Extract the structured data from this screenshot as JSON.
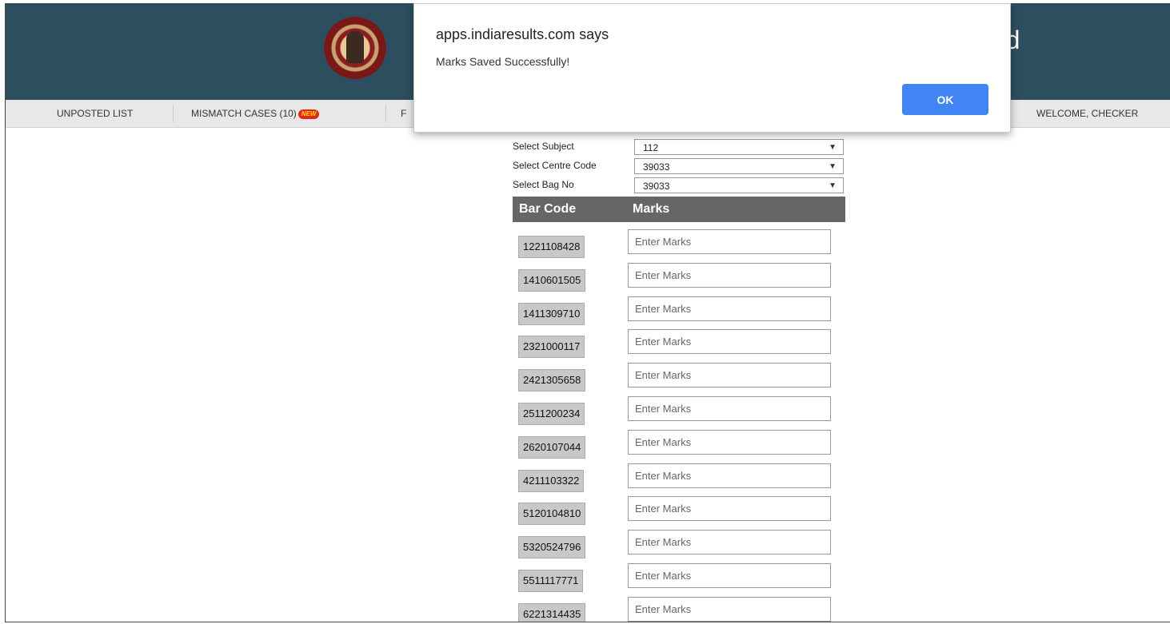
{
  "header": {
    "title_partial": "rd"
  },
  "nav": {
    "items": [
      {
        "label": "UNPOSTED LIST"
      },
      {
        "label": "MISMATCH CASES (10)",
        "badge": "NEW"
      },
      {
        "label": "F"
      }
    ],
    "welcome": "WELCOME, CHECKER"
  },
  "form": {
    "subject": {
      "label": "Select Subject",
      "value": "112"
    },
    "centre": {
      "label": "Select Centre Code",
      "value": "39033"
    },
    "bag": {
      "label": "Select Bag No",
      "value": "39033"
    }
  },
  "table": {
    "headers": {
      "barcode": "Bar Code",
      "marks": "Marks"
    },
    "placeholder": "Enter Marks",
    "rows": [
      "1221108428",
      "1410601505",
      "1411309710",
      "2321000117",
      "2421305658",
      "2511200234",
      "2620107044",
      "4211103322",
      "5120104810",
      "5320524796",
      "5511117771",
      "6221314435"
    ]
  },
  "dialog": {
    "title": "apps.indiaresults.com says",
    "message": "Marks Saved Successfully!",
    "ok_label": "OK"
  },
  "colors": {
    "header_bg": "#2d4e5e",
    "ok_button": "#4285f4",
    "table_header": "#666666",
    "badge": "#e8241c"
  }
}
